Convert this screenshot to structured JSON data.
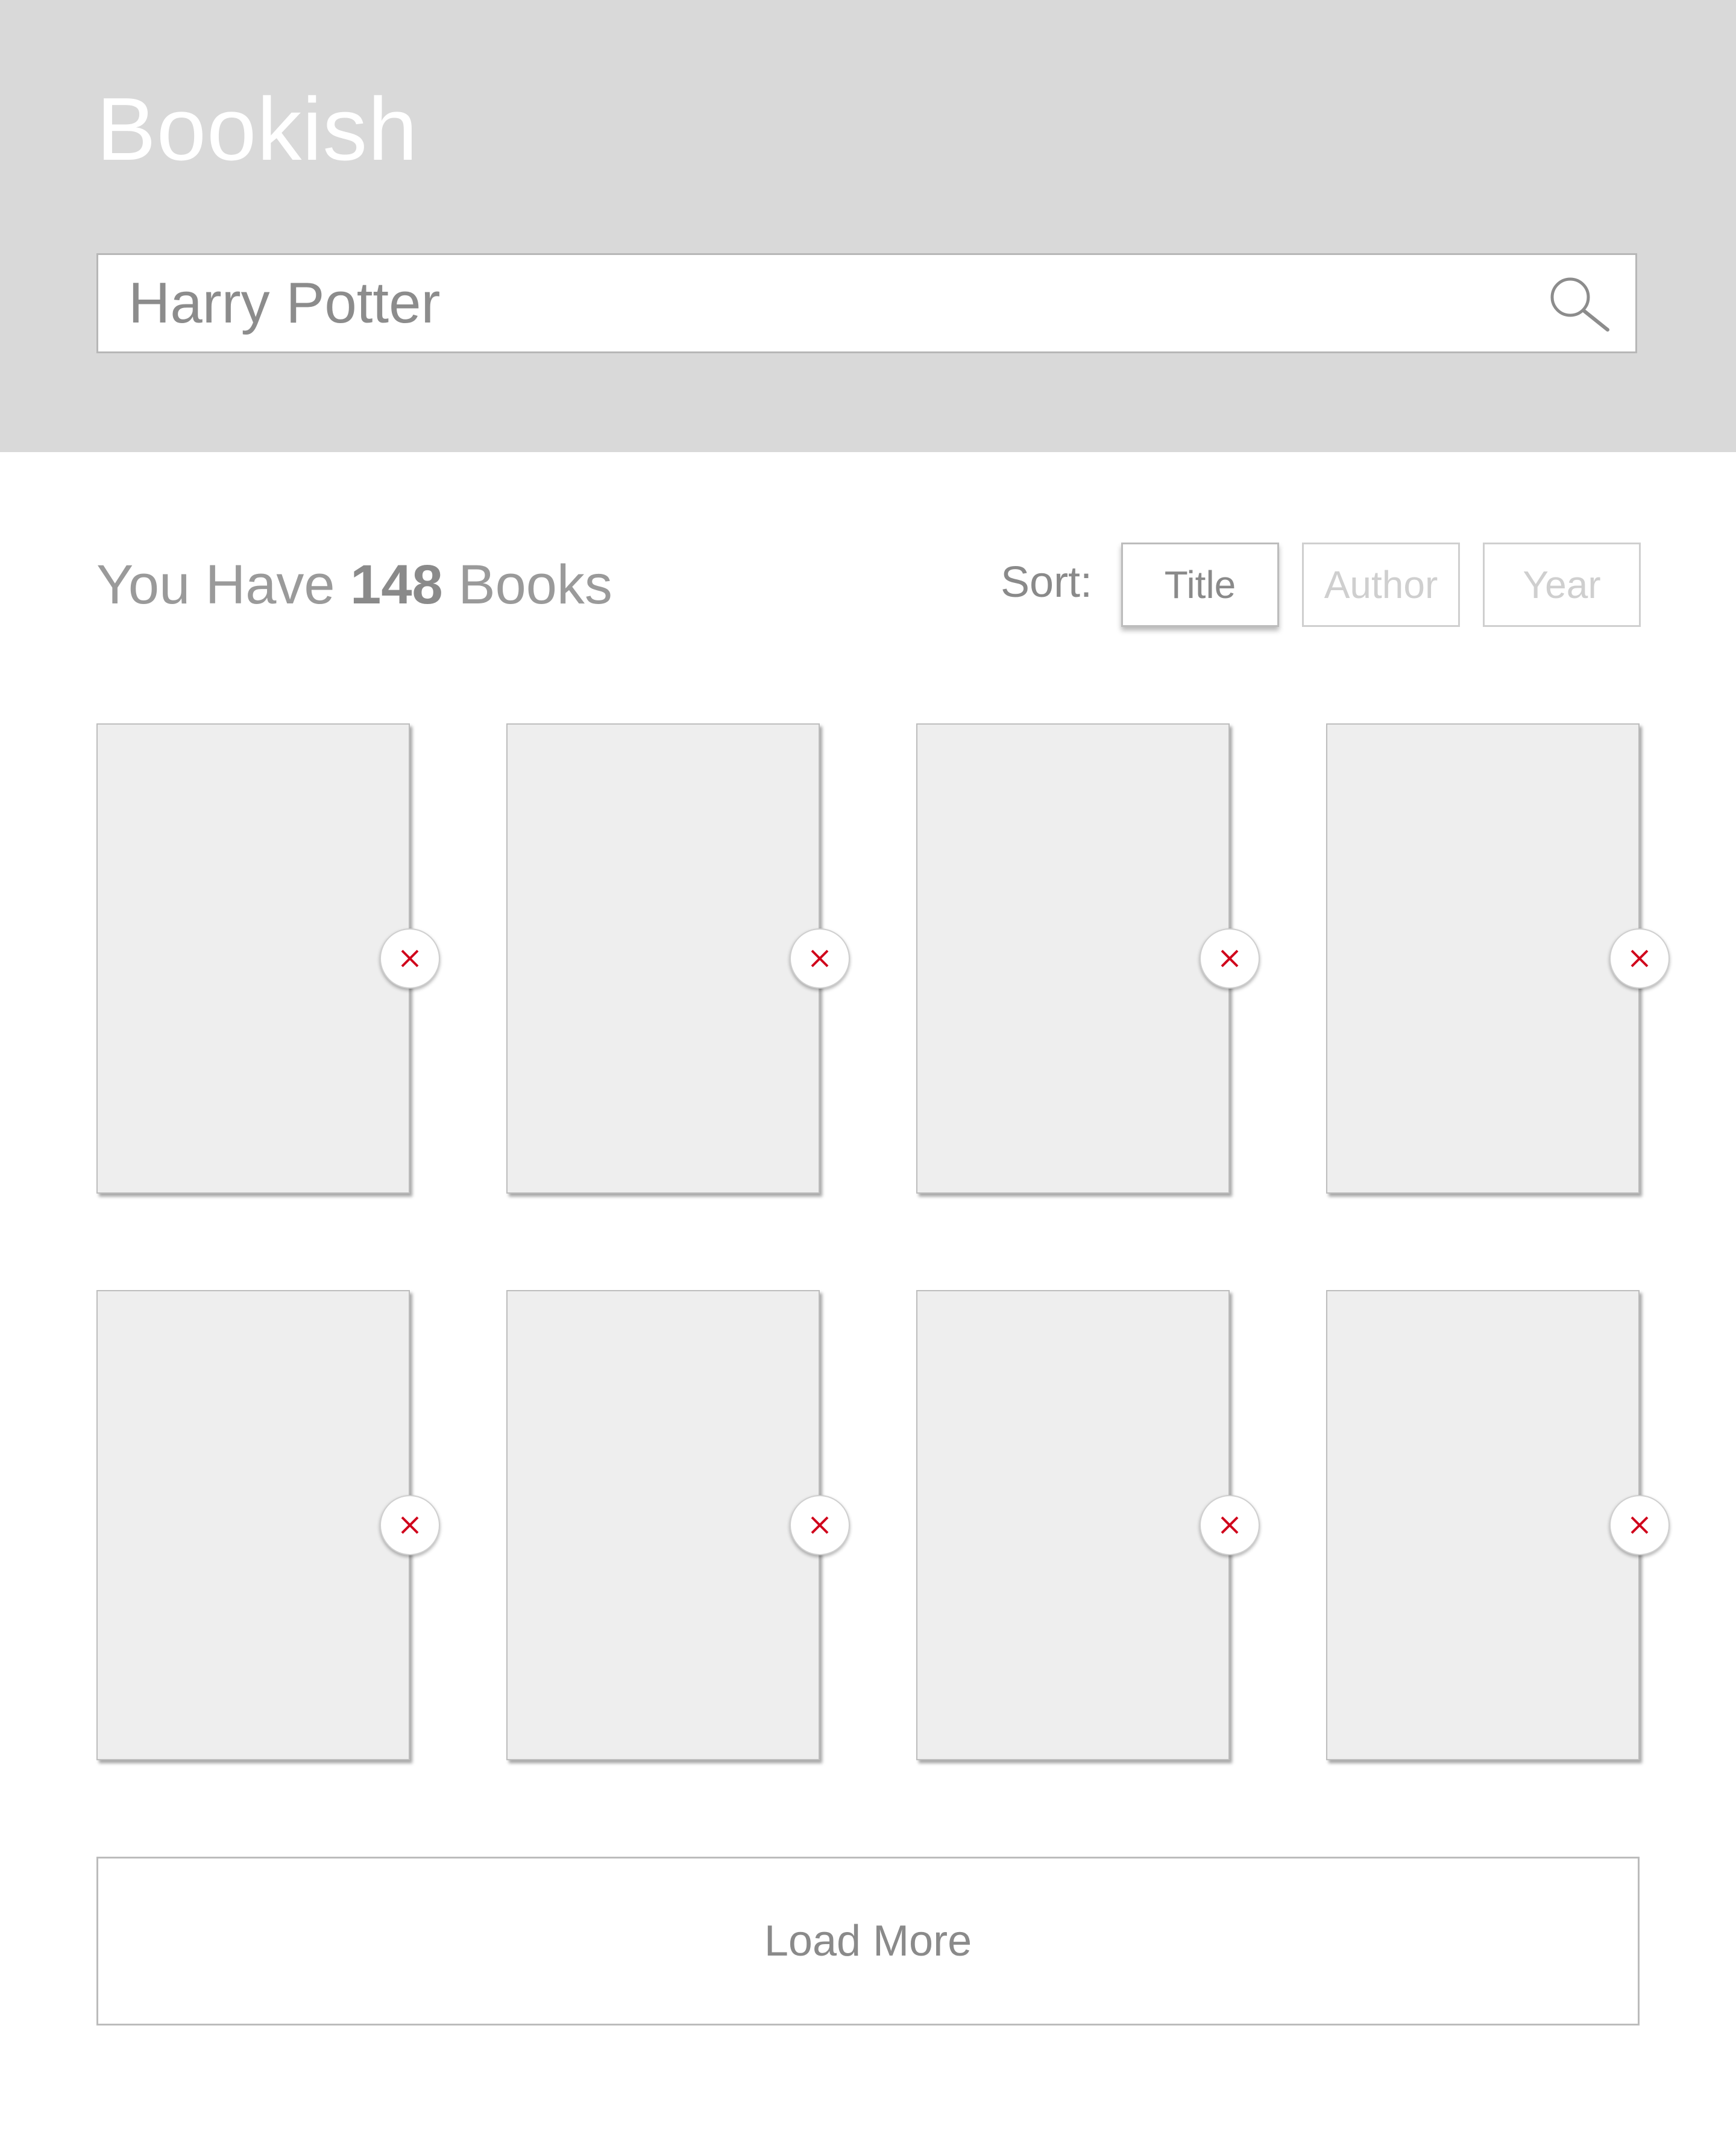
{
  "header": {
    "app_title": "Bookish",
    "background_color": "#d9d9d9"
  },
  "search": {
    "value": "Harry Potter",
    "icon": "search-icon"
  },
  "summary": {
    "prefix": "You Have",
    "count": "148",
    "suffix": "Books"
  },
  "sort": {
    "label": "Sort:",
    "options": [
      {
        "label": "Title",
        "active": true
      },
      {
        "label": "Author",
        "active": false
      },
      {
        "label": "Year",
        "active": false
      }
    ]
  },
  "books": {
    "count_shown": 8,
    "remove_icon": "close-icon",
    "remove_icon_color": "#d0021b"
  },
  "load_more": {
    "label": "Load More"
  }
}
